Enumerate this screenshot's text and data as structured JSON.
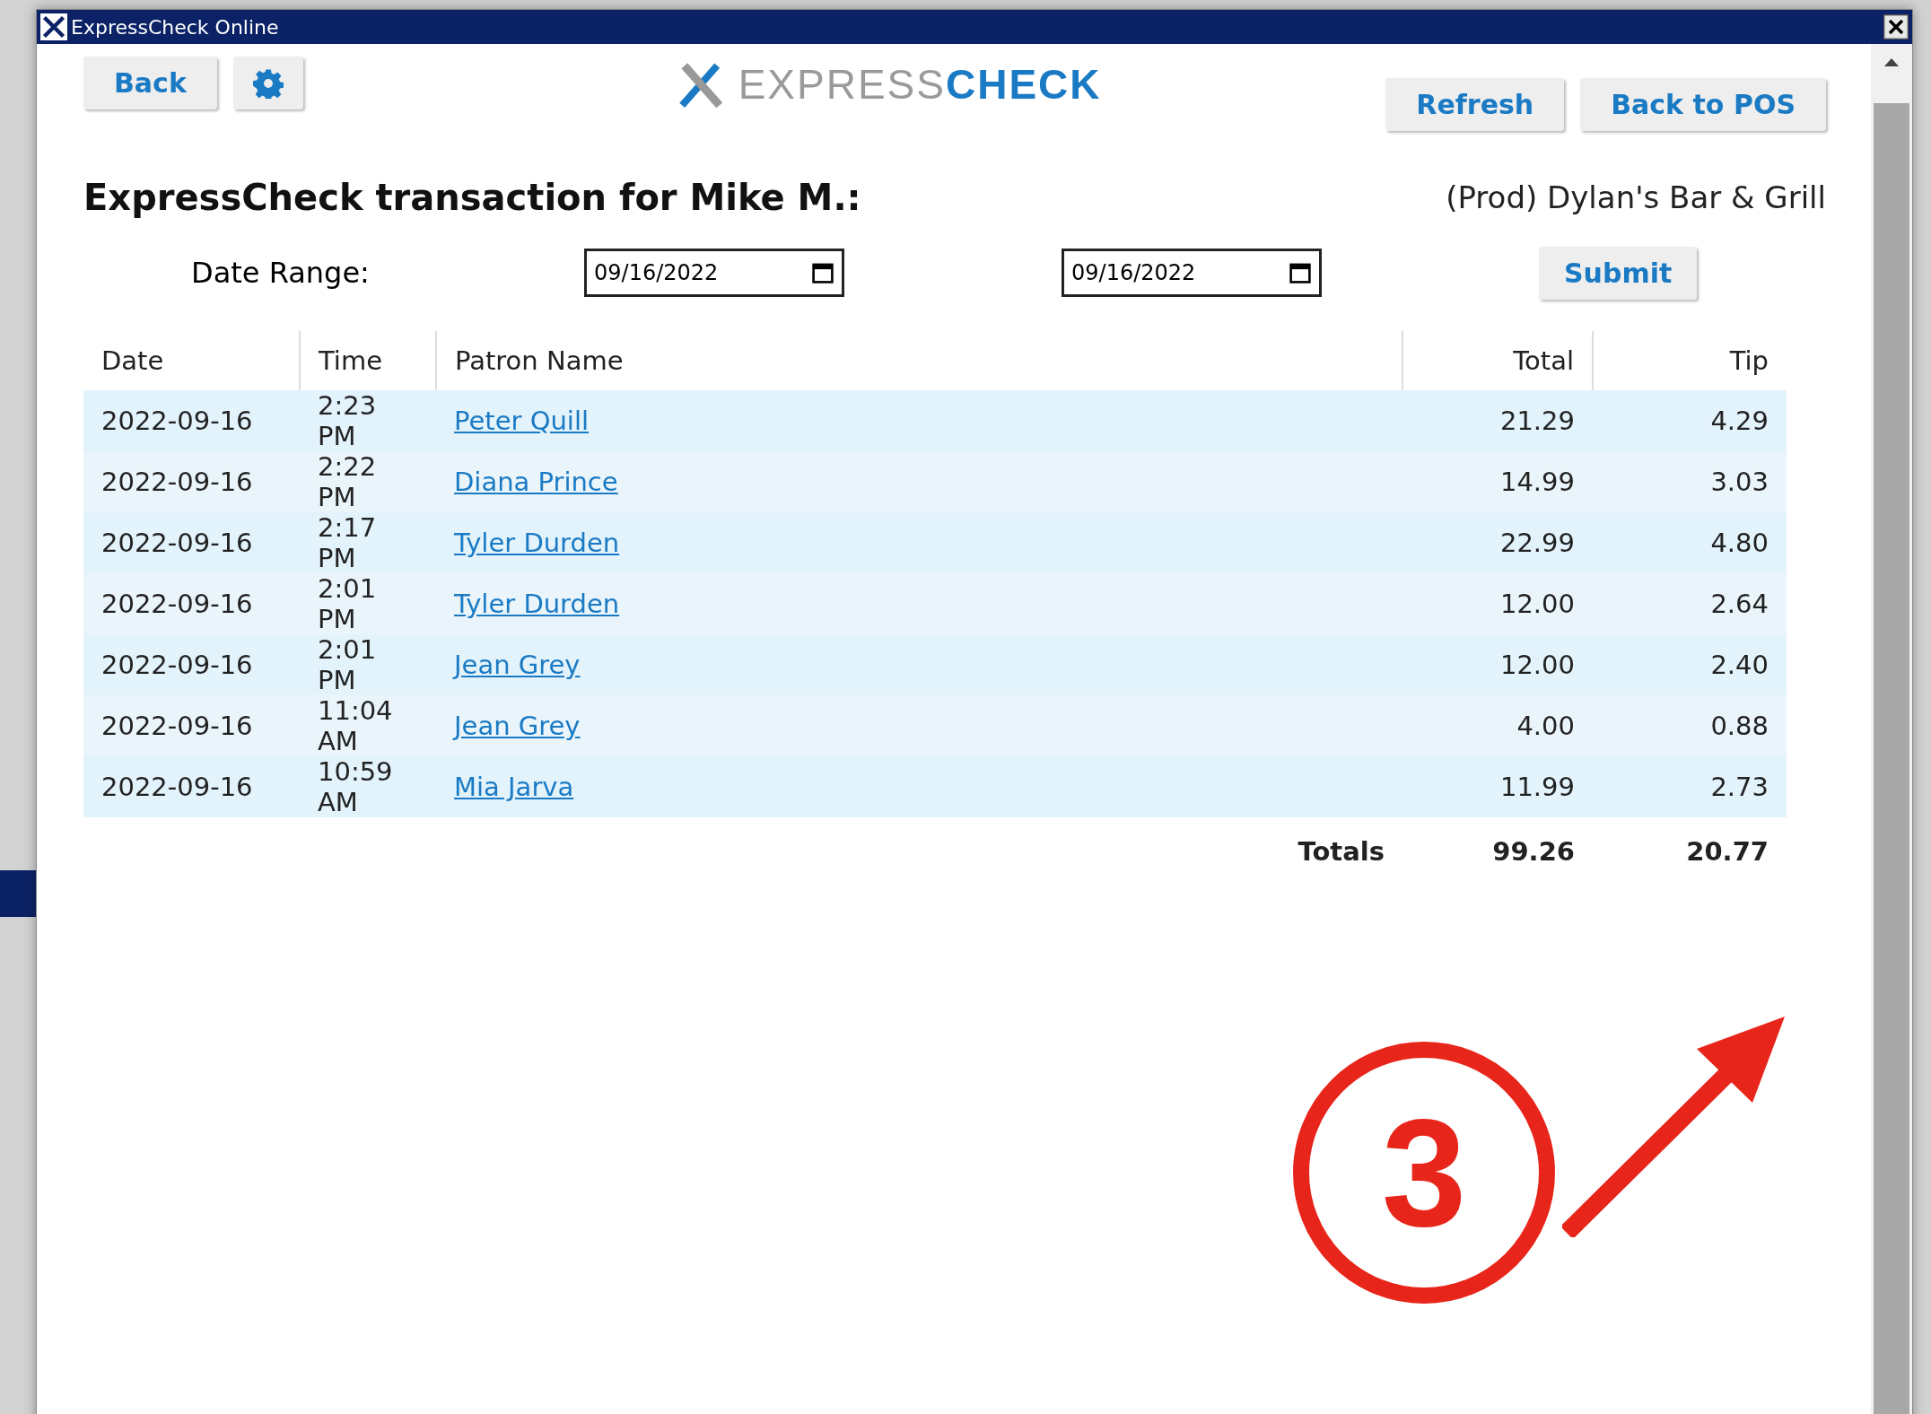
{
  "window": {
    "title": "ExpressCheck Online"
  },
  "toolbar": {
    "back": "Back",
    "refresh": "Refresh",
    "back_to_pos": "Back to POS"
  },
  "logo": {
    "part_1": "EXPRESS",
    "part_2": "CHECK"
  },
  "heading": "ExpressCheck transaction for Mike M.:",
  "location": "(Prod) Dylan's Bar & Grill",
  "date_range": {
    "label": "Date Range:",
    "from": "09/16/2022",
    "to": "09/16/2022",
    "submit": "Submit"
  },
  "table": {
    "columns": [
      "Date",
      "Time",
      "Patron Name",
      "Total",
      "Tip"
    ],
    "rows": [
      {
        "date": "2022-09-16",
        "time": "2:23 PM",
        "patron": "Peter Quill",
        "total": "21.29",
        "tip": "4.29"
      },
      {
        "date": "2022-09-16",
        "time": "2:22 PM",
        "patron": "Diana Prince",
        "total": "14.99",
        "tip": "3.03"
      },
      {
        "date": "2022-09-16",
        "time": "2:17 PM",
        "patron": "Tyler Durden",
        "total": "22.99",
        "tip": "4.80"
      },
      {
        "date": "2022-09-16",
        "time": "2:01 PM",
        "patron": "Tyler Durden",
        "total": "12.00",
        "tip": "2.64"
      },
      {
        "date": "2022-09-16",
        "time": "2:01 PM",
        "patron": "Jean Grey",
        "total": "12.00",
        "tip": "2.40"
      },
      {
        "date": "2022-09-16",
        "time": "11:04 AM",
        "patron": "Jean Grey",
        "total": "4.00",
        "tip": "0.88"
      },
      {
        "date": "2022-09-16",
        "time": "10:59 AM",
        "patron": "Mia Jarva",
        "total": "11.99",
        "tip": "2.73"
      }
    ],
    "totals": {
      "label": "Totals",
      "total": "99.26",
      "tip": "20.77"
    }
  },
  "annotation": {
    "number": "3"
  }
}
